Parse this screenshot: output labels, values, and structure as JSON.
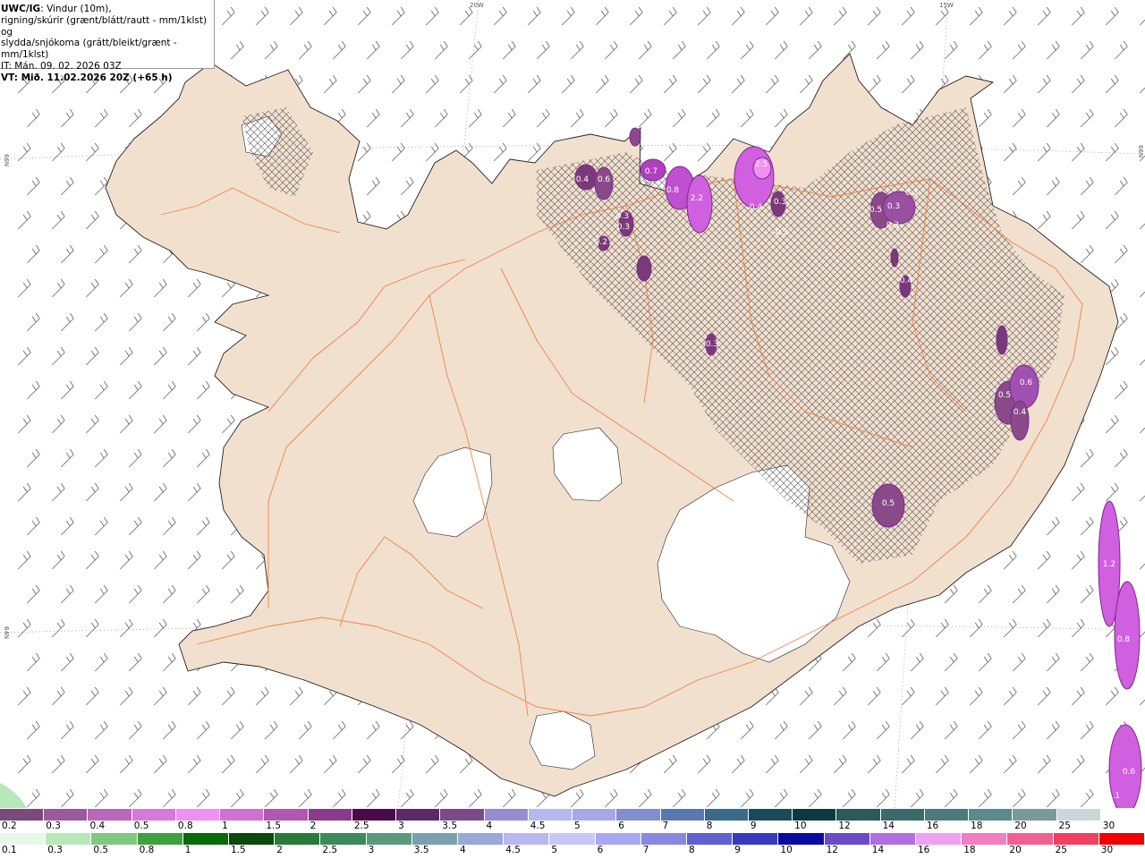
{
  "header": {
    "model": "UWC/IG",
    "line1_rest": ": Vindur (10m),",
    "line2": "rigning/skúrir (grænt/blátt/rautt - mm/1klst) og",
    "line3": "slydda/snjókoma (grátt/bleikt/grænt - mm/1klst)",
    "init_time": "IT: Mán. 09. 02. 2026 03Z",
    "valid_time": "VT: Mið. 11.02.2026 20Z (+65 h)"
  },
  "map": {
    "graticule_labels": {
      "lon_20w": "20W",
      "lon_15w": "15W",
      "lat_66n_left": "66N",
      "lat_66n_right": "66N",
      "lat_64n_left": "64N"
    },
    "precip_labels": [
      "0.4",
      "0.6",
      "0.7",
      "0.8",
      "2.2",
      "2.5",
      "0.4",
      "0.3",
      "0.3",
      "0.3",
      "0.3",
      "0.5",
      "0.3",
      "0.3",
      "0.3",
      "0.4",
      "0.2",
      "0.3",
      "0.5",
      "0.6",
      "0.4",
      "0.5",
      "1.2",
      "0.8",
      "0.6",
      "1.1"
    ],
    "colors": {
      "land": "#f2e0cf",
      "roads": "#f07838",
      "glacier": "#ffffff",
      "coast": "#000000",
      "snow": "#c040d0"
    }
  },
  "scale_snow": {
    "labels": [
      "0.2",
      "0.3",
      "0.4",
      "0.5",
      "0.8",
      "1",
      "1.5",
      "2",
      "2.5",
      "3",
      "3.5",
      "4",
      "4.5",
      "5",
      "6",
      "7",
      "8",
      "9",
      "10",
      "12",
      "14",
      "16",
      "18",
      "20",
      "25",
      "30"
    ],
    "colors": [
      "#7a4a7a",
      "#9b5a9b",
      "#b868b8",
      "#d878d8",
      "#f090f0",
      "#d070d0",
      "#b058b0",
      "#8c3a8c",
      "#4a0a4a",
      "#5a2a6a",
      "#7a4a8a",
      "#9a8ad0",
      "#b8b8f0",
      "#a8a8e8",
      "#7f8fd0",
      "#5a78b0",
      "#3a6a8a",
      "#1a4a5a",
      "#0a3a40",
      "#2a5a5a",
      "#3a6a6a",
      "#4a7a7a",
      "#5a8a8a",
      "#7a9a9a",
      "#c8d8d8",
      "#ffffff"
    ]
  },
  "scale_rain": {
    "labels": [
      "0.1",
      "0.3",
      "0.5",
      "0.8",
      "1",
      "1.5",
      "2",
      "2.5",
      "3",
      "3.5",
      "4",
      "4.5",
      "5",
      "6",
      "7",
      "8",
      "9",
      "10",
      "12",
      "14",
      "16",
      "18",
      "20",
      "25",
      "30"
    ],
    "colors": [
      "#e8f8e8",
      "#b8e8b8",
      "#80c880",
      "#40a040",
      "#0a6a0a",
      "#0a4a0a",
      "#2a7a3a",
      "#3a8a5a",
      "#5a9a7a",
      "#7aa0b0",
      "#9aa8d8",
      "#b8b8f0",
      "#c8c8f8",
      "#a8a8f0",
      "#8888e0",
      "#6060d0",
      "#3a3ac0",
      "#0a0aa0",
      "#6a4ac8",
      "#b070e0",
      "#f0a0f0",
      "#f080c0",
      "#f06090",
      "#f04060",
      "#f00000"
    ]
  }
}
